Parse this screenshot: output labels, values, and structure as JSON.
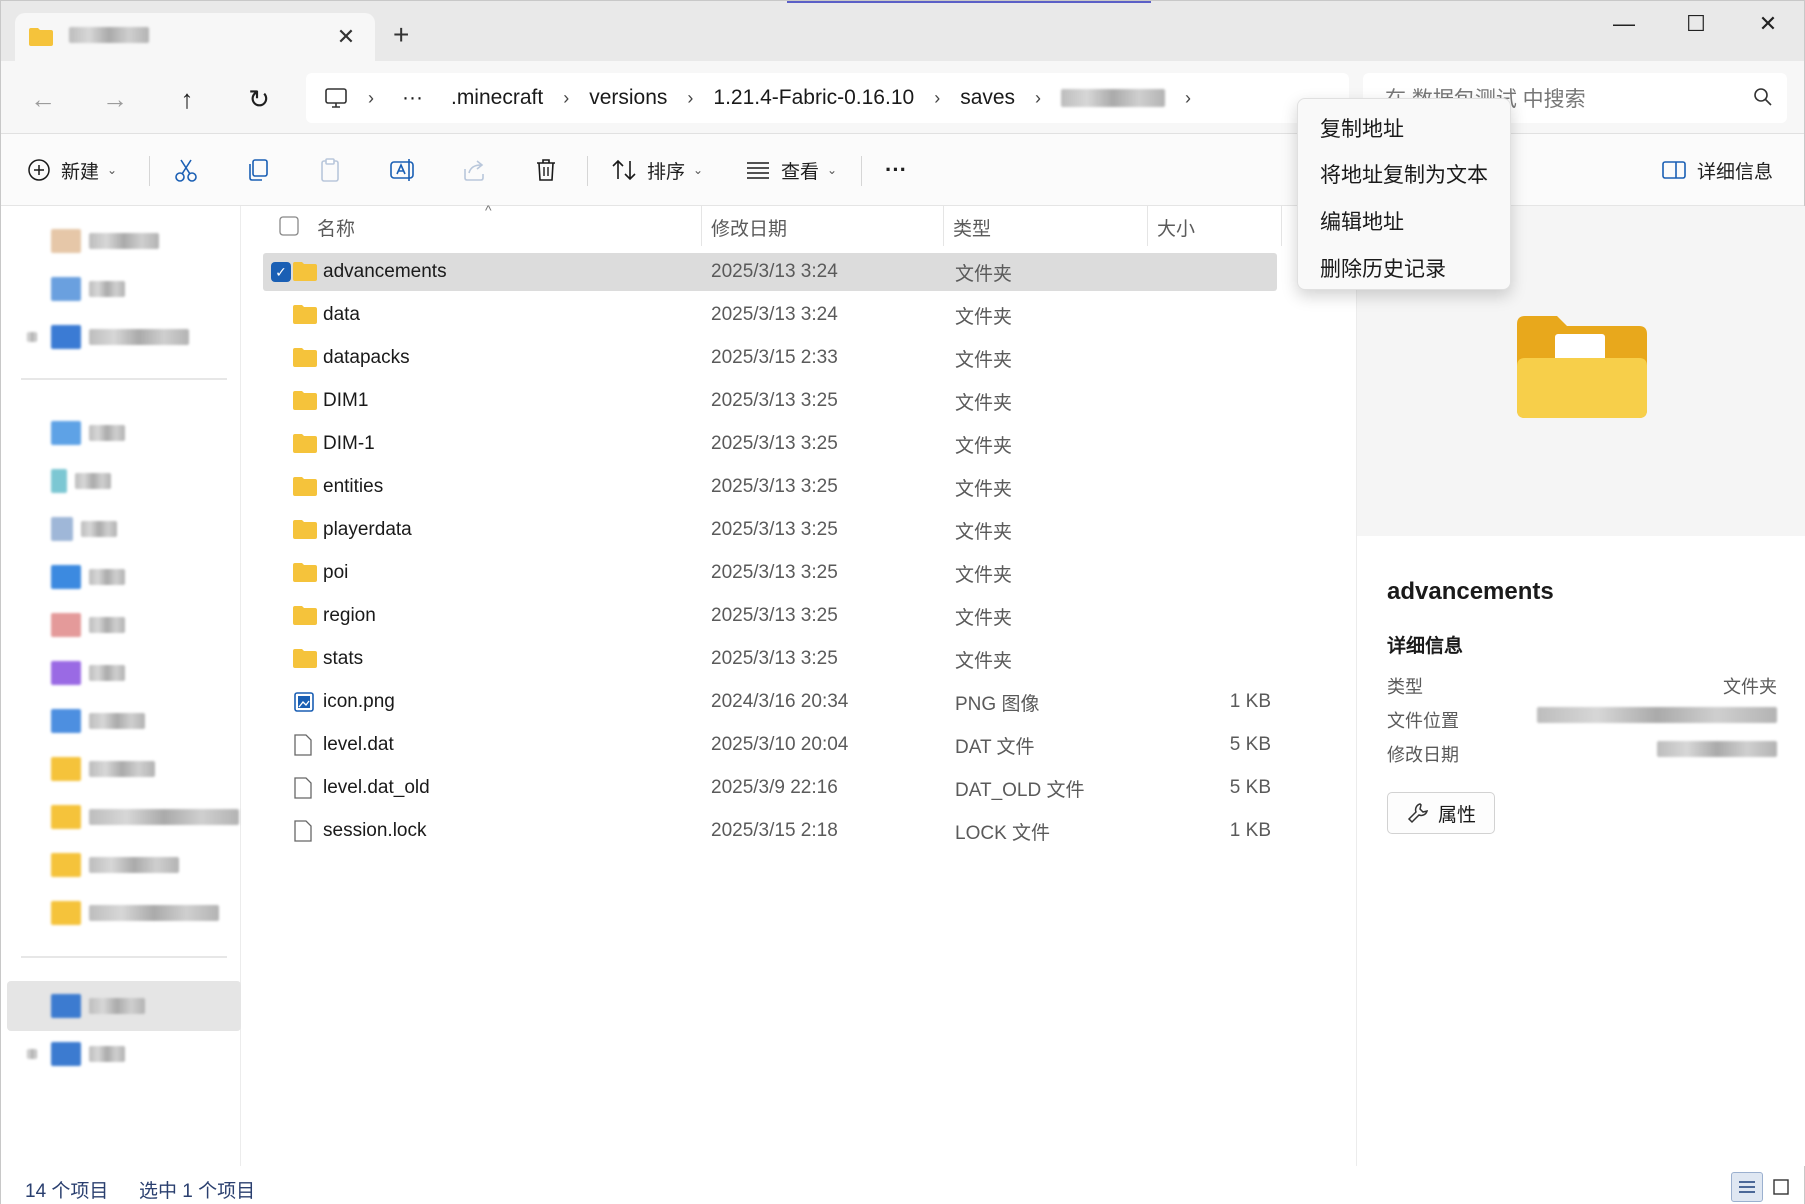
{
  "tab": {
    "close": "✕",
    "new": "+"
  },
  "window": {
    "minimize": "—",
    "maximize": "☐",
    "close": "✕"
  },
  "nav": {
    "back": "←",
    "forward": "→",
    "up": "↑",
    "refresh": "↻",
    "more": "···",
    "breadcrumbs": [
      ".minecraft",
      "versions",
      "1.21.4-Fabric-0.16.10",
      "saves"
    ],
    "search_placeholder": "在 数据包测试 中搜索"
  },
  "toolbar": {
    "new_label": "新建",
    "sort_label": "排序",
    "view_label": "查看",
    "more": "···",
    "details_label": "详细信息"
  },
  "columns": {
    "name": "名称",
    "date": "修改日期",
    "type": "类型",
    "size": "大小"
  },
  "files": [
    {
      "name": "advancements",
      "date": "2025/3/13 3:24",
      "type": "文件夹",
      "size": "",
      "icon": "folder-icon",
      "selected": true
    },
    {
      "name": "data",
      "date": "2025/3/13 3:24",
      "type": "文件夹",
      "size": "",
      "icon": "folder-icon"
    },
    {
      "name": "datapacks",
      "date": "2025/3/15 2:33",
      "type": "文件夹",
      "size": "",
      "icon": "folder-icon"
    },
    {
      "name": "DIM1",
      "date": "2025/3/13 3:25",
      "type": "文件夹",
      "size": "",
      "icon": "folder-icon"
    },
    {
      "name": "DIM-1",
      "date": "2025/3/13 3:25",
      "type": "文件夹",
      "size": "",
      "icon": "folder-icon"
    },
    {
      "name": "entities",
      "date": "2025/3/13 3:25",
      "type": "文件夹",
      "size": "",
      "icon": "folder-icon"
    },
    {
      "name": "playerdata",
      "date": "2025/3/13 3:25",
      "type": "文件夹",
      "size": "",
      "icon": "folder-icon"
    },
    {
      "name": "poi",
      "date": "2025/3/13 3:25",
      "type": "文件夹",
      "size": "",
      "icon": "folder-icon"
    },
    {
      "name": "region",
      "date": "2025/3/13 3:25",
      "type": "文件夹",
      "size": "",
      "icon": "folder-icon"
    },
    {
      "name": "stats",
      "date": "2025/3/13 3:25",
      "type": "文件夹",
      "size": "",
      "icon": "folder-icon"
    },
    {
      "name": "icon.png",
      "date": "2024/3/16 20:34",
      "type": "PNG 图像",
      "size": "1 KB",
      "icon": "image-file-icon"
    },
    {
      "name": "level.dat",
      "date": "2025/3/10 20:04",
      "type": "DAT 文件",
      "size": "5 KB",
      "icon": "file-icon"
    },
    {
      "name": "level.dat_old",
      "date": "2025/3/9 22:16",
      "type": "DAT_OLD 文件",
      "size": "5 KB",
      "icon": "file-icon"
    },
    {
      "name": "session.lock",
      "date": "2025/3/15 2:18",
      "type": "LOCK 文件",
      "size": "1 KB",
      "icon": "file-icon"
    }
  ],
  "context_menu": [
    "复制地址",
    "将地址复制为文本",
    "编辑地址",
    "删除历史记录"
  ],
  "details": {
    "name": "advancements",
    "section": "详细信息",
    "type_label": "类型",
    "type_value": "文件夹",
    "location_label": "文件位置",
    "modified_label": "修改日期",
    "properties_label": "属性"
  },
  "status": {
    "count": "14 个项目",
    "selected": "选中 1 个项目"
  },
  "colors": {
    "accent": "#1a5fb4",
    "folder": "#f5c33b",
    "selection": "#dcdcdc"
  }
}
